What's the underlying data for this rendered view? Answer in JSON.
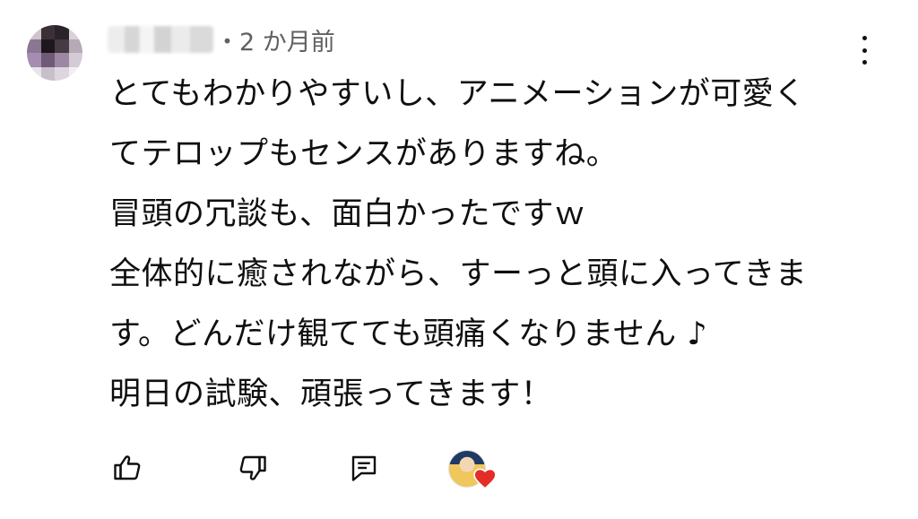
{
  "comment": {
    "timestamp": "・2 か月前",
    "lines": [
      "とてもわかりやすいし、アニメーションが可愛く",
      "てテロップもセンスがありますね。",
      "冒頭の冗談も、面白かったですｗ",
      "全体的に癒されながら、すーっと頭に入ってきま",
      "す。どんだけ観てても頭痛くなりません ♪",
      "明日の試験、頑張ってきます！"
    ]
  },
  "icons": {
    "avatar": "blurred-avatar",
    "menu": "more-vert-icon",
    "like": "thumb-up-icon",
    "dislike": "thumb-down-icon",
    "reply": "reply-comment-icon",
    "creator_heart": "creator-heart-icon"
  },
  "colors": {
    "text": "#0f0f0f",
    "secondary_text": "#606060",
    "heart": "#e52d27"
  }
}
